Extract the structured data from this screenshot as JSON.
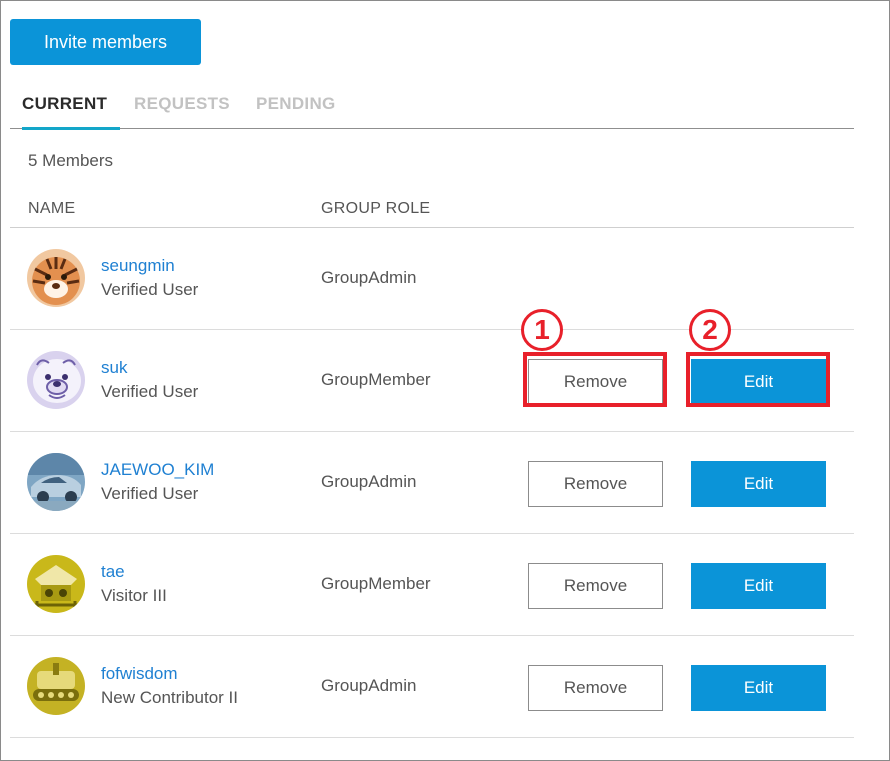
{
  "invite_label": "Invite members",
  "tabs": [
    {
      "label": "CURRENT",
      "active": true
    },
    {
      "label": "REQUESTS",
      "active": false
    },
    {
      "label": "PENDING",
      "active": false
    }
  ],
  "member_count": "5 Members",
  "columns": {
    "name": "NAME",
    "role": "GROUP ROLE"
  },
  "members": [
    {
      "username": "seungmin",
      "rank": "Verified User",
      "role": "GroupAdmin",
      "avatar": "tiger-avatar",
      "has_actions": false
    },
    {
      "username": "suk",
      "rank": "Verified User",
      "role": "GroupMember",
      "avatar": "polar-bear-avatar",
      "has_actions": true
    },
    {
      "username": "JAEWOO_KIM",
      "rank": "Verified User",
      "role": "GroupAdmin",
      "avatar": "car-avatar",
      "has_actions": true
    },
    {
      "username": "tae",
      "rank": "Visitor III",
      "role": "GroupMember",
      "avatar": "yellow-robot-avatar",
      "has_actions": true
    },
    {
      "username": "fofwisdom",
      "rank": "New Contributor II",
      "role": "GroupAdmin",
      "avatar": "yellow-tank-avatar",
      "has_actions": true
    }
  ],
  "actions": {
    "remove_label": "Remove",
    "edit_label": "Edit"
  },
  "annotations": [
    {
      "marker": "1",
      "target": "remove-button"
    },
    {
      "marker": "2",
      "target": "edit-button"
    }
  ],
  "colors": {
    "accent": "#0b94d8",
    "tab_underline": "#13a6c9",
    "link": "#1f80d2",
    "annotation": "#e8202a"
  }
}
